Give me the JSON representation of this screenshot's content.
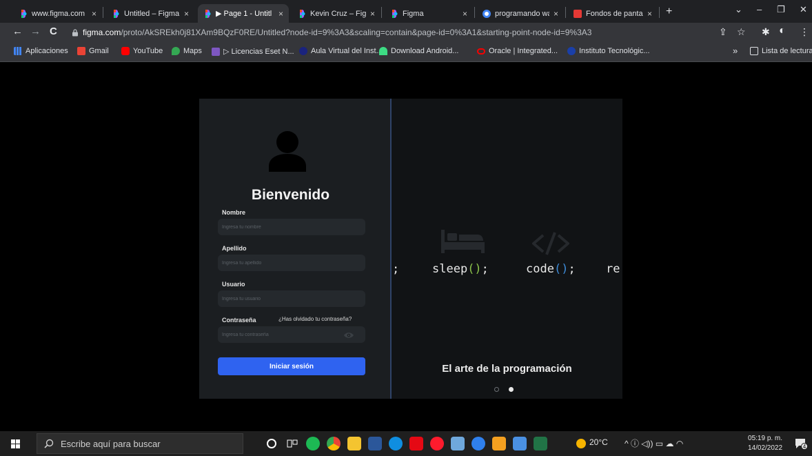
{
  "tabs": [
    {
      "title": "www.figma.com",
      "color": "#a259ff"
    },
    {
      "title": "Untitled – Figma",
      "color": "#a259ff"
    },
    {
      "title": "▶ Page 1 - Untitl",
      "color": "#a259ff"
    },
    {
      "title": "Kevin Cruz – Figm",
      "color": "#a259ff"
    },
    {
      "title": "Figma",
      "color": "#a259ff"
    },
    {
      "title": "programando wa",
      "color": "#4285f4"
    },
    {
      "title": "Fondos de panta",
      "color": "#e53935"
    }
  ],
  "tab_close": "×",
  "new_tab": "+",
  "window_controls": {
    "chevron": "⌄",
    "minimize": "–",
    "restore": "❐",
    "close": "✕"
  },
  "nav": {
    "back": "←",
    "forward": "→",
    "reload": "C"
  },
  "address": {
    "host": "figma.com",
    "path": "/proto/AkSREkh0j81XAm9BQzF0RE/Untitled?node-id=9%3A3&scaling=contain&page-id=0%3A1&starting-point-node-id=9%3A3"
  },
  "toolbar_icons": {
    "share": "⇪",
    "star": "☆",
    "extensions": "✱",
    "profile": "◐",
    "menu": "⋮"
  },
  "bookmarks": [
    {
      "label": "Aplicaciones",
      "color": "#4285f4"
    },
    {
      "label": "Gmail",
      "color": "#ea4335"
    },
    {
      "label": "YouTube",
      "color": "#ff0000"
    },
    {
      "label": "Maps",
      "color": "#34a853"
    },
    {
      "label": "▷ Licencias Eset N...",
      "color": "#7e57c2"
    },
    {
      "label": "Aula Virtual del Inst...",
      "color": "#1a237e"
    },
    {
      "label": "Download Android...",
      "color": "#3ddc84"
    },
    {
      "label": "Oracle | Integrated...",
      "color": "#f80000"
    },
    {
      "label": "Instituto Tecnológic...",
      "color": "#1a3fa8"
    }
  ],
  "bookmarks_more": "»",
  "reading_list": "Lista de lectura",
  "login": {
    "title": "Bienvenido",
    "fields": [
      {
        "label": "Nombre",
        "placeholder": "Ingresa tu nombre"
      },
      {
        "label": "Apellido",
        "placeholder": "Ingresa tu apellido"
      },
      {
        "label": "Usuario",
        "placeholder": "Ingresa tu usuario"
      },
      {
        "label": "Contraseña",
        "placeholder": "Ingresa tu contraseña"
      }
    ],
    "forgot": "¿Has olvidado tu contraseña?",
    "submit": "Iniciar sesión",
    "accent": "#2f63f0"
  },
  "hero": {
    "semicolon": ";",
    "sleep_word": "sleep",
    "code_word": "code",
    "parens": "()",
    "end": ";",
    "repeat_partial": "re",
    "tagline": "El arte de la programación"
  },
  "taskbar": {
    "search_placeholder": "Escribe aquí para buscar",
    "weather": "20°C",
    "tray_icons": "^ ⓘ ◁)) ▭ ☁ ◠",
    "time": "05:19 p. m.",
    "date": "14/02/2022",
    "notif_count": "4"
  }
}
